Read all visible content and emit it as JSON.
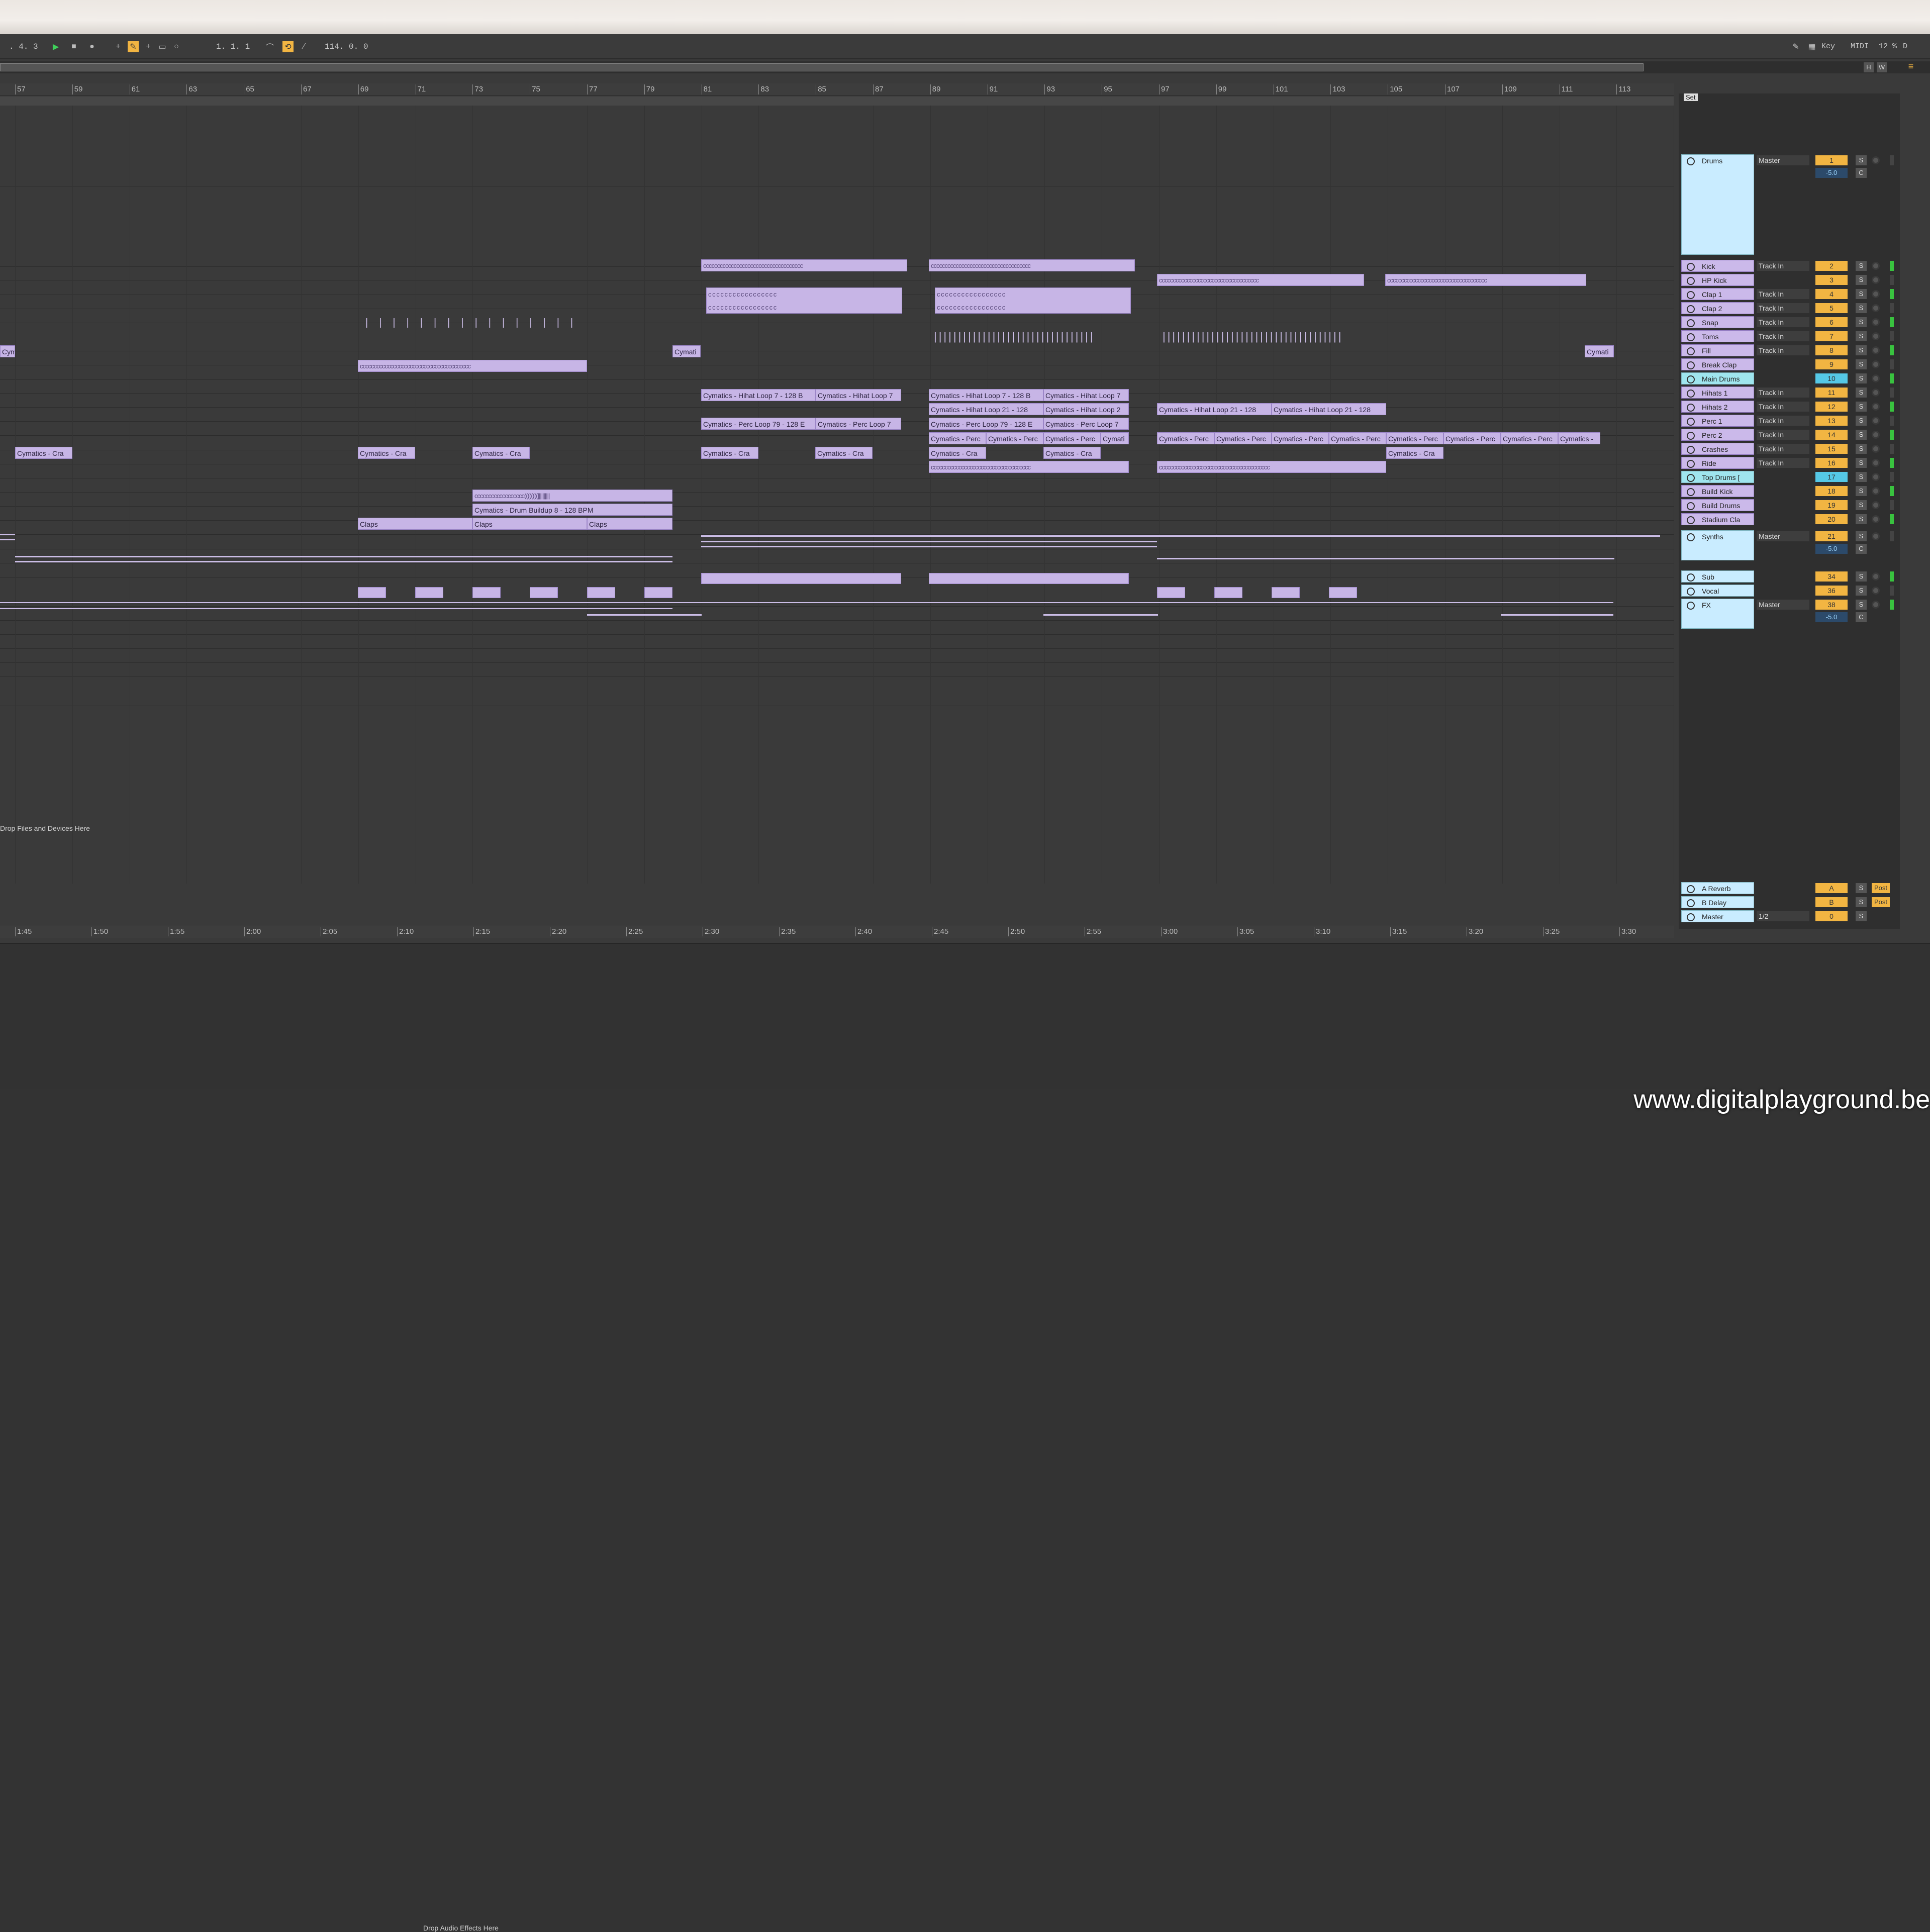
{
  "transport": {
    "position_left": ". 4. 3",
    "arrangement_pos": "1. 1. 1",
    "tempo_value": "114. 0. 0",
    "key_label": "Key",
    "midi_label": "MIDI",
    "cpu": "12 %",
    "d_label": "D",
    "hw_h": "H",
    "hw_w": "W"
  },
  "ruler_bars": [
    "57",
    "59",
    "61",
    "63",
    "65",
    "67",
    "69",
    "71",
    "73",
    "75",
    "77",
    "79",
    "81",
    "83",
    "85",
    "87",
    "89",
    "91",
    "93",
    "95",
    "97",
    "99",
    "101",
    "103",
    "105",
    "107",
    "109",
    "111",
    "113"
  ],
  "time_ticks": [
    "1:45",
    "1:50",
    "1:55",
    "2:00",
    "2:05",
    "2:10",
    "2:15",
    "2:20",
    "2:25",
    "2:30",
    "2:35",
    "2:40",
    "2:45",
    "2:50",
    "2:55",
    "3:00",
    "3:05",
    "3:10",
    "3:15",
    "3:20",
    "3:25",
    "3:30"
  ],
  "set_label": "Set",
  "drop_files": "Drop Files and Devices Here",
  "drop_audio": "Drop Audio Effects Here",
  "watermark": "www.digitalplayground.be",
  "clips": {
    "cymati": "Cymati",
    "hihat7": "Cymatics - Hihat Loop 7 - 128 B",
    "hihat7b": "Cymatics - Hihat Loop 7",
    "hihat21": "Cymatics - Hihat Loop 21 - 128",
    "hihat21b": "Cymatics - Hihat Loop 2",
    "perc79": "Cymatics - Perc Loop 79 - 128 E",
    "perc7": "Cymatics - Perc Loop 7",
    "perc": "Cymatics - Perc",
    "crash": "Cymatics - Cra",
    "buildup": "Cymatics - Drum Buildup 8 - 128 BPM",
    "claps": "Claps",
    "cymatics": "Cymatics -"
  },
  "tracks": [
    {
      "name": "Drums",
      "route": "Master",
      "num": "1",
      "color": "blue"
    },
    {
      "name": "Kick",
      "route": "Track In",
      "num": "2",
      "color": "purple"
    },
    {
      "name": "HP Kick",
      "route": "",
      "num": "3",
      "color": "purple"
    },
    {
      "name": "Clap 1",
      "route": "Track In",
      "num": "4",
      "color": "purple"
    },
    {
      "name": "Clap 2",
      "route": "Track In",
      "num": "5",
      "color": "purple"
    },
    {
      "name": "Snap",
      "route": "Track In",
      "num": "6",
      "color": "purple"
    },
    {
      "name": "Toms",
      "route": "Track In",
      "num": "7",
      "color": "purple"
    },
    {
      "name": "Fill",
      "route": "Track In",
      "num": "8",
      "color": "purple"
    },
    {
      "name": "Break Clap",
      "route": "",
      "num": "9",
      "color": "purple"
    },
    {
      "name": "Main Drums",
      "route": "",
      "num": "10",
      "color": "cyan"
    },
    {
      "name": "Hihats 1",
      "route": "Track In",
      "num": "11",
      "color": "purple"
    },
    {
      "name": "Hihats 2",
      "route": "Track In",
      "num": "12",
      "color": "purple"
    },
    {
      "name": "Perc 1",
      "route": "Track In",
      "num": "13",
      "color": "purple"
    },
    {
      "name": "Perc 2",
      "route": "Track In",
      "num": "14",
      "color": "purple"
    },
    {
      "name": "Crashes",
      "route": "Track In",
      "num": "15",
      "color": "purple"
    },
    {
      "name": "Ride",
      "route": "Track In",
      "num": "16",
      "color": "purple"
    },
    {
      "name": "Top Drums [",
      "route": "",
      "num": "17",
      "color": "cyan"
    },
    {
      "name": "Build Kick",
      "route": "",
      "num": "18",
      "color": "purple"
    },
    {
      "name": "Build Drums",
      "route": "",
      "num": "19",
      "color": "purple"
    },
    {
      "name": "Stadium Cla",
      "route": "",
      "num": "20",
      "color": "purple"
    },
    {
      "name": "Synths",
      "route": "Master",
      "num": "21",
      "color": "blue"
    },
    {
      "name": "Sub",
      "route": "",
      "num": "34",
      "color": "blue"
    },
    {
      "name": "Vocal",
      "route": "",
      "num": "36",
      "color": "blue"
    },
    {
      "name": "FX",
      "route": "Master",
      "num": "38",
      "color": "blue"
    }
  ],
  "group_vol": "-5.0",
  "group_pan": "C",
  "inf": "-inf",
  "returns": [
    {
      "name": "A Reverb",
      "num": "A",
      "post": "Post"
    },
    {
      "name": "B Delay",
      "num": "B",
      "post": "Post"
    },
    {
      "name": "Master",
      "num": "0",
      "route": "1/2"
    }
  ],
  "solo": "S"
}
